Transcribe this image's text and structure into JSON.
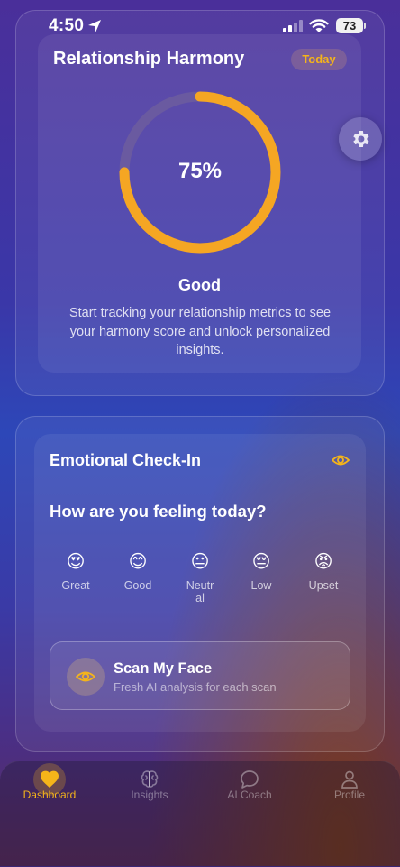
{
  "status_bar": {
    "time": "4:50",
    "battery": "73"
  },
  "harmony": {
    "title": "Relationship Harmony",
    "badge": "Today",
    "percent": 75,
    "percent_label": "75%",
    "status": "Good",
    "description": "Start tracking your relationship metrics to see your harmony score and unlock personalized insights."
  },
  "checkin": {
    "title": "Emotional Check-In",
    "question": "How are you feeling today?",
    "moods": [
      {
        "emoji": "😍",
        "label": "Great"
      },
      {
        "emoji": "😊",
        "label": "Good"
      },
      {
        "emoji": "😐",
        "label": "Neutral"
      },
      {
        "emoji": "😔",
        "label": "Low"
      },
      {
        "emoji": "😡",
        "label": "Upset"
      }
    ],
    "scan_title": "Scan My Face",
    "scan_subtitle": "Fresh AI analysis for each scan"
  },
  "tabs": [
    {
      "label": "Dashboard",
      "icon": "heart-icon",
      "active": true
    },
    {
      "label": "Insights",
      "icon": "brain-icon",
      "active": false
    },
    {
      "label": "AI Coach",
      "icon": "chat-bubble-icon",
      "active": false
    },
    {
      "label": "Profile",
      "icon": "person-icon",
      "active": false
    }
  ],
  "colors": {
    "accent": "#f5a623",
    "ring_track": "#6a5aa0",
    "badge_text": "#f5b41a"
  }
}
